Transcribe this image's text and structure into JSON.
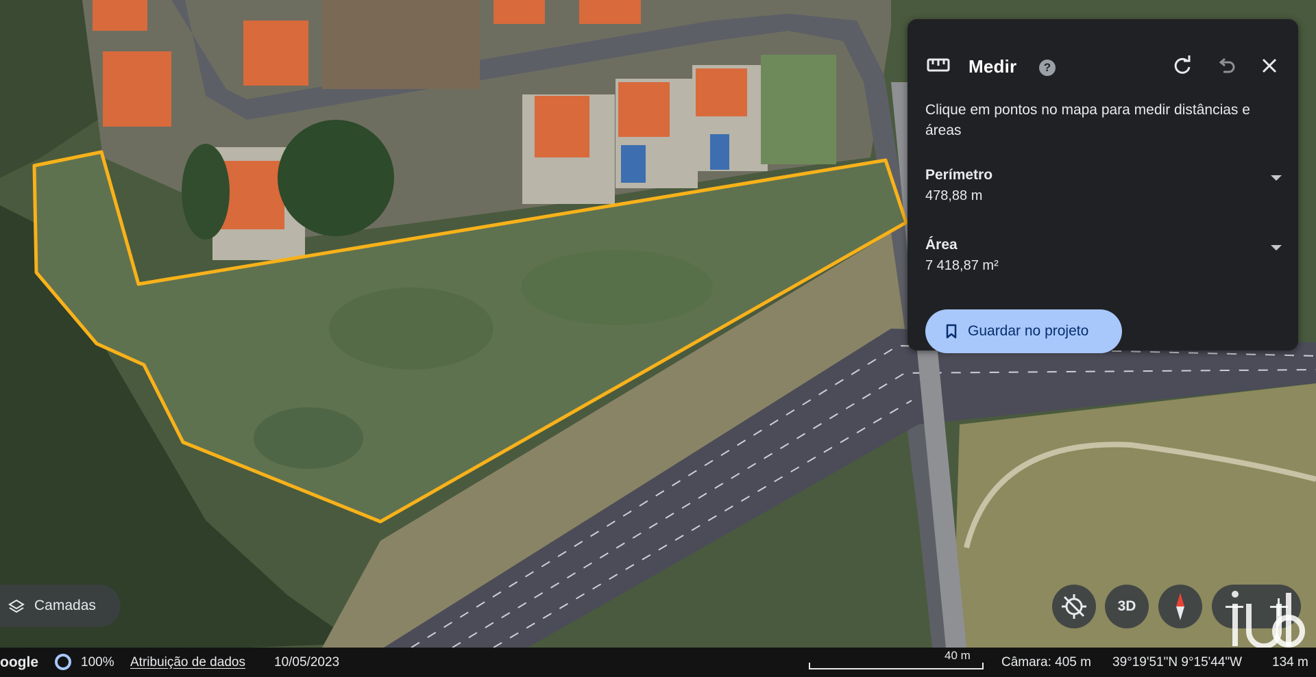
{
  "measure_panel": {
    "title": "Medir",
    "help_icon": "?",
    "instructions": "Clique em pontos no mapa para medir distâncias e áreas",
    "perimeter": {
      "label": "Perímetro",
      "value": "478,88 m"
    },
    "area": {
      "label": "Área",
      "value": "7 418,87 m²"
    },
    "save_button": "Guardar no projeto",
    "icons": [
      "ruler-icon",
      "help-icon",
      "redo-icon",
      "undo-icon",
      "close-icon",
      "chevron-down-icon",
      "bookmark-icon"
    ]
  },
  "layers": {
    "label": "Camadas",
    "icon": "layers-icon"
  },
  "controls": {
    "three_d_label": "3D",
    "icons": [
      "location-off-icon",
      "compass-icon",
      "zoom-out-icon",
      "zoom-in-icon"
    ]
  },
  "watermark": {
    "text": "iad"
  },
  "status_bar": {
    "brand": "oogle",
    "zoom": "100%",
    "attribution": "Atribuição de dados",
    "date": "10/05/2023",
    "scale": "40 m",
    "camera": "Câmara: 405 m",
    "coordinates": "39°19'51\"N 9°15'44\"W",
    "distance": "134 m"
  },
  "colors": {
    "polygon_outline": "#f9b21a",
    "panel_bg": "#202124",
    "save_button_bg": "#a8c7fa",
    "save_button_text": "#062e6f",
    "field_green": "#5f7250",
    "road": "#4b4c58"
  }
}
